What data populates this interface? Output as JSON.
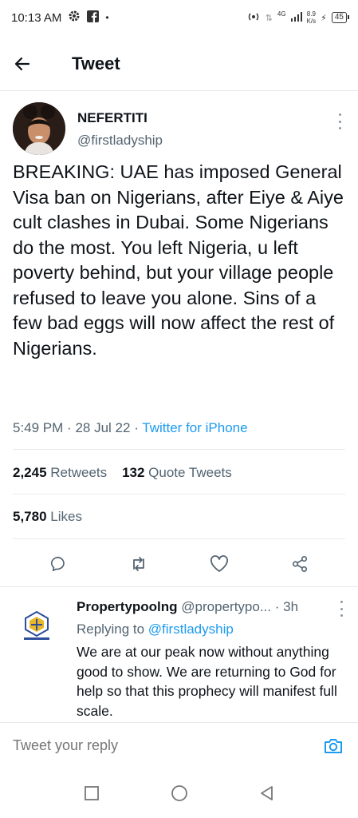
{
  "status_bar": {
    "time": "10:13 AM",
    "network_type": "4G",
    "net_speed_value": "8.9",
    "net_speed_unit": "K/s",
    "battery": "45"
  },
  "header": {
    "title": "Tweet"
  },
  "tweet": {
    "author_name": "NEFERTITI",
    "author_handle": "@firstladyship",
    "text": "BREAKING: UAE has imposed General Visa ban on Nigerians, after Eiye & Aiye cult clashes in Dubai. Some Nigerians do the most. You left Nigeria, u left poverty behind, but your village people refused to leave you alone. Sins of a few bad eggs will now affect the rest of Nigerians.",
    "time": "5:49 PM",
    "date": "28 Jul 22",
    "separator": "·",
    "source": "Twitter for iPhone",
    "retweets_count": "2,245",
    "retweets_label": "Retweets",
    "quotes_count": "132",
    "quotes_label": "Quote Tweets",
    "likes_count": "5,780",
    "likes_label": "Likes"
  },
  "actions": [
    "reply-icon",
    "retweet-icon",
    "like-icon",
    "share-icon"
  ],
  "reply": {
    "name": "Propertypoolng",
    "handle": "@propertypo...",
    "time": "· 3h",
    "replying_prefix": "Replying to",
    "replying_to": "@firstladyship",
    "text": "We are at our peak now without anything good to show. We are returning to God for help so that this prophecy will manifest full scale."
  },
  "reply_bar": {
    "placeholder": "Tweet your reply"
  },
  "colors": {
    "accent": "#1d9bf0",
    "secondary_text": "#536471",
    "divider": "#e6e9ec"
  }
}
